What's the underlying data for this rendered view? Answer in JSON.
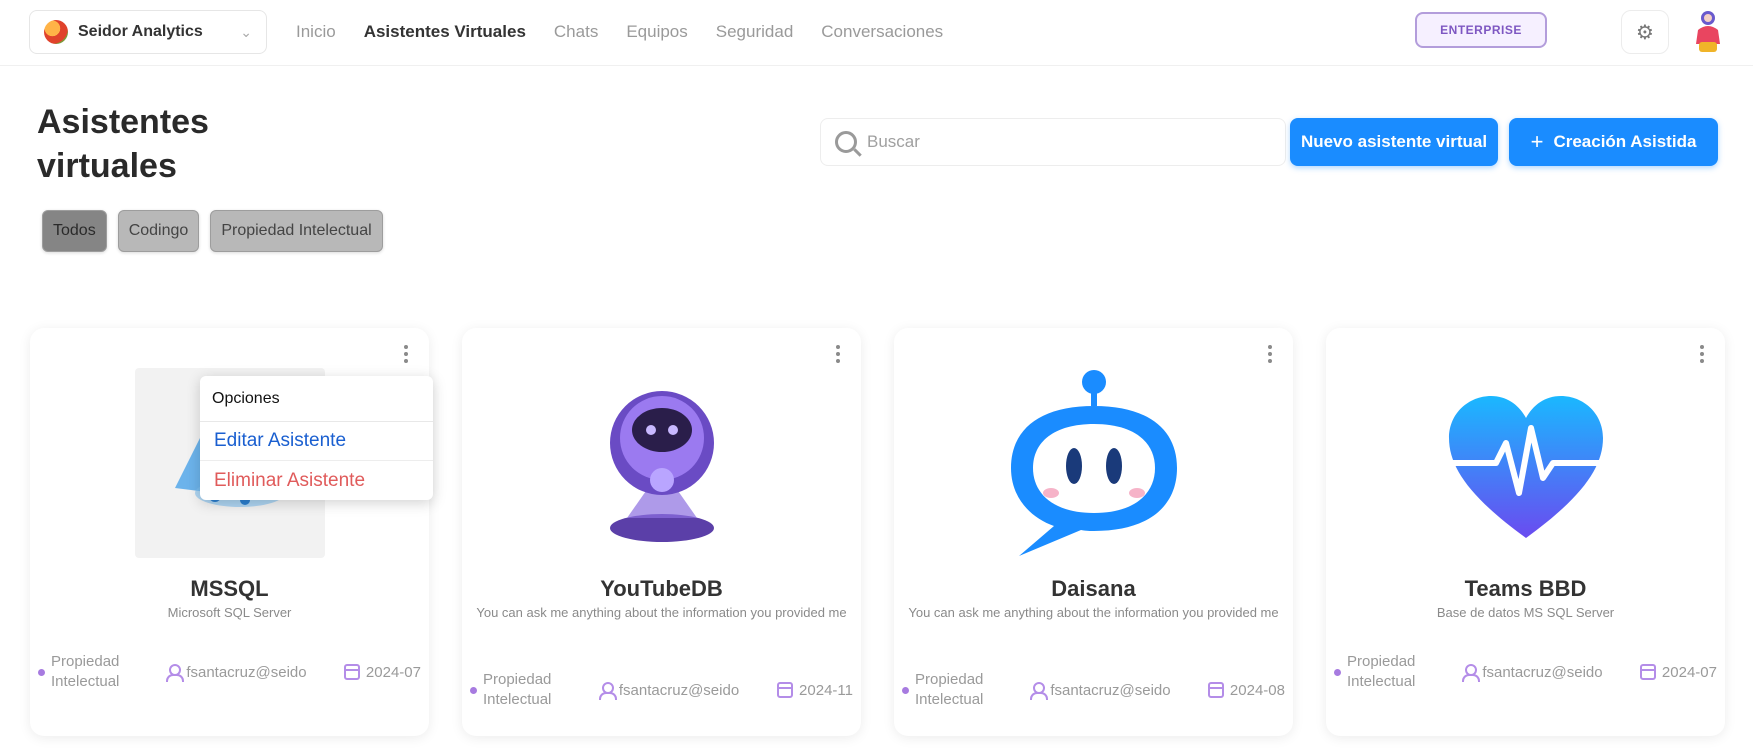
{
  "header": {
    "org_name": "Seidor Analytics",
    "nav": [
      "Inicio",
      "Asistentes Virtuales",
      "Chats",
      "Equipos",
      "Seguridad",
      "Conversaciones"
    ],
    "active_nav_index": 1,
    "badge": "ENTERPRISE"
  },
  "page": {
    "title_line1": "Asistentes",
    "title_line2": "virtuales"
  },
  "search": {
    "placeholder": "Buscar",
    "value": ""
  },
  "actions": {
    "new_label": "Nuevo asistente virtual",
    "create_label": "Creación Asistida"
  },
  "filters": {
    "chips": [
      "Todos",
      "Codingo",
      "Propiedad Intelectual"
    ],
    "active_index": 0
  },
  "cards": [
    {
      "name": "MSSQL",
      "description": "Microsoft SQL Server",
      "category": "Propiedad Intelectual",
      "owner": "fsantacruz@seido",
      "date": "2024-07",
      "image": "database-cloud-logo"
    },
    {
      "name": "YouTubeDB",
      "description": "You can ask me anything about the information you provided me",
      "category": "Propiedad Intelectual",
      "owner": "fsantacruz@seido",
      "date": "2024-11",
      "image": "robot-globe-icon"
    },
    {
      "name": "Daisana",
      "description": "You can ask me anything about the information you provided me",
      "category": "Propiedad Intelectual",
      "owner": "fsantacruz@seido",
      "date": "2024-08",
      "image": "chat-bot-icon"
    },
    {
      "name": "Teams BBD",
      "description": "Base de datos MS SQL Server",
      "category": "Propiedad Intelectual",
      "owner": "fsantacruz@seido",
      "date": "2024-07",
      "image": "heart-pulse-icon"
    }
  ],
  "menu": {
    "title": "Opciones",
    "edit": "Editar Asistente",
    "delete": "Eliminar Asistente"
  },
  "colors": {
    "primary": "#1a8cff",
    "accent_purple": "#a77be0",
    "danger": "#e05b5b",
    "link": "#1a5fd0"
  }
}
